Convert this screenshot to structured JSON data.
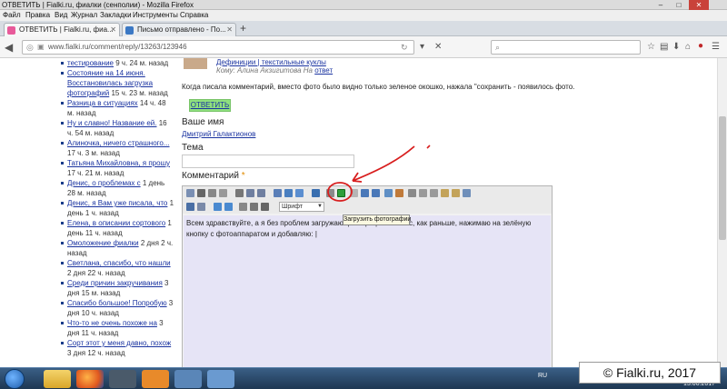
{
  "window": {
    "title": "ОТВЕТИТЬ | Fialki.ru, фиалки (сенполии) - Mozilla Firefox",
    "minimize": "–",
    "maximize": "□",
    "close": "✕"
  },
  "menu": [
    "Файл",
    "Правка",
    "Вид",
    "Журнал",
    "Закладки",
    "Инструменты",
    "Справка"
  ],
  "tabs": [
    {
      "label": "ОТВЕТИТЬ | Fialki.ru, фиа...",
      "active": true,
      "icon_color": "#e85a9a"
    },
    {
      "label": "Письмо отправлено - По...",
      "active": false,
      "icon_color": "#3b78c4"
    }
  ],
  "new_tab": "+",
  "nav": {
    "url": "www.fialki.ru/comment/reply/13263/123946"
  },
  "sidebar": [
    {
      "link": "тестирование",
      "ago": " 9 ч. 24 м. назад"
    },
    {
      "link": "Состояние на 14 июня. Восстановилась загрузка фотографий",
      "ago": " 15 ч. 23 м. назад"
    },
    {
      "link": "Разница в ситуациях",
      "ago": " 14 ч. 48 м. назад"
    },
    {
      "link": "Ну и славно! Название ей.",
      "ago": " 16 ч. 54 м. назад"
    },
    {
      "link": "Алиночка, ничего страшного...",
      "ago": " 17 ч. 3 м. назад"
    },
    {
      "link": "Татьяна Михайловна, я прошу",
      "ago": " 17 ч. 21 м. назад"
    },
    {
      "link": "Денис, о проблемах с",
      "ago": " 1 день 28 м. назад"
    },
    {
      "link": "Денис, я Вам уже писала, что",
      "ago": " 1 день 1 ч. назад"
    },
    {
      "link": "Елена, в описании сортового",
      "ago": " 1 день 11 ч. назад"
    },
    {
      "link": "Омоложение фиалки",
      "ago": " 2 дня 2 ч. назад"
    },
    {
      "link": "Светлана, спасибо, что нашли",
      "ago": " 2 дня 22 ч. назад"
    },
    {
      "link": "Среди причин закручивания",
      "ago": " 3 дня 15 м. назад"
    },
    {
      "link": "Спасибо большое! Попробую",
      "ago": " 3 дня 10 ч. назад"
    },
    {
      "link": "Что-то не очень похоже на",
      "ago": " 3 дня 11 ч. назад"
    },
    {
      "link": "Сорт этот у меня давно, похож",
      "ago": " 3 дня 12 ч. назад"
    }
  ],
  "main": {
    "top_links": "Дефиниции | текстильные куклы",
    "to_prefix": "Кому: Алина Акзигитова  На ",
    "to_answer": "ответ",
    "message": "Когда писала комментарий, вместо фото было видно только зеленое окошко, нажала \"сохранить - появилось фото.",
    "reply_button": "ОТВЕТИТЬ",
    "name_label": "Ваше имя",
    "name_value": "Дмитрий Галактионов",
    "theme_label": "Тема",
    "comment_label": "Комментарий",
    "required_mark": "*"
  },
  "editor": {
    "font_select": "Шрифт",
    "tooltip": "Загрузить фотографии",
    "text": "Всем здравствуйте, а я без проблем загружаю фотографии сейчас, как раньше, нажимаю на зелёную кнопку с фотоаппаратом и добавляю: |"
  },
  "taskbar": {
    "lang": "RU",
    "date": "15.06.2017"
  },
  "watermark": "© Fialki.ru, 2017",
  "colors": {
    "reply_button": "#8fe07e",
    "editor_area": "#e6e4f6",
    "annotation": "#d81e1e",
    "link": "#1a33a0"
  }
}
